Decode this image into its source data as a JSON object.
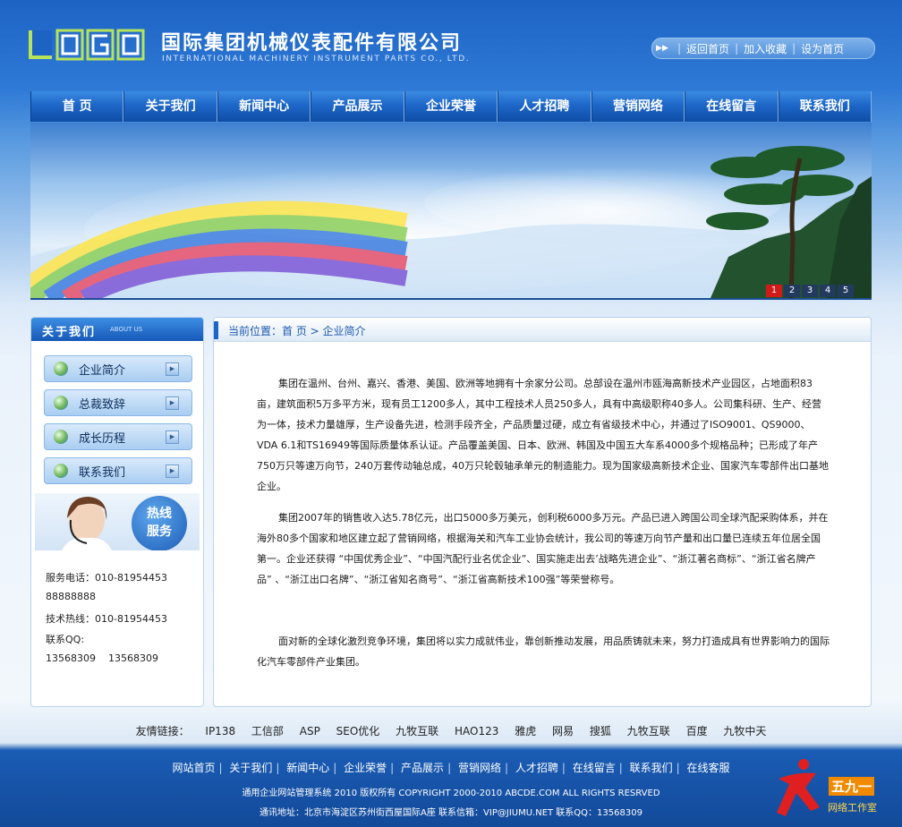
{
  "header": {
    "logo_text": "LOGO",
    "company_cn": "国际集团机械仪表配件有限公司",
    "company_en": "INTERNATIONAL MACHINERY INSTRUMENT PARTS CO., LTD.",
    "top_links": [
      "返回首页",
      "加入收藏",
      "设为首页"
    ]
  },
  "nav": [
    "首  页",
    "关于我们",
    "新闻中心",
    "产品展示",
    "企业荣誉",
    "人才招聘",
    "营销网络",
    "在线留言",
    "联系我们"
  ],
  "banner": {
    "slides": [
      "1",
      "2",
      "3",
      "4",
      "5"
    ],
    "active_slide": "1"
  },
  "sidebar": {
    "title": "关于我们",
    "subtitle": "ABOUT US",
    "items": [
      "企业简介",
      "总裁致辞",
      "成长历程",
      "联系我们"
    ],
    "hotline_badge": [
      "热线",
      "服务"
    ],
    "contact": {
      "phone_label": "服务电话：010-81954453",
      "phone_extra": "88888888",
      "tech_label": "技术热线：010-81954453",
      "qq_label": "联系QQ:",
      "qq_values": "13568309    13568309"
    }
  },
  "main": {
    "breadcrumb": "当前位置：首 页 > 企业简介",
    "paragraphs": [
      "集团在温州、台州、嘉兴、香港、美国、欧洲等地拥有十余家分公司。总部设在温州市瓯海高新技术产业园区，占地面积83亩，建筑面积5万多平方米，现有员工1200多人，其中工程技术人员250多人，具有中高级职称40多人。公司集科研、生产、经营为一体，技术力量雄厚，生产设备先进，检测手段齐全，产品质量过硬，成立有省级技术中心，并通过了ISO9001、QS9000、VDA 6.1和TS16949等国际质量体系认证。产品覆盖美国、日本、欧洲、韩国及中国五大车系4000多个规格品种；已形成了年产750万只等速万向节，240万套传动轴总成，40万只轮毂轴承单元的制造能力。现为国家级高新技术企业、国家汽车零部件出口基地企业。",
      "集团2007年的销售收入达5.78亿元，出口5000多万美元，创利税6000多万元。产品已进入跨国公司全球汽配采购体系，并在海外80多个国家和地区建立起了营销网络，根据海关和汽车工业协会统计，我公司的等速万向节产量和出口量已连续五年位居全国第一。企业还获得 “中国优秀企业”、“中国汽配行业名优企业”、国实施走出去’战略先进企业”、“浙江著名商标”、“浙江省名牌产品” 、“浙江出口名牌”、“浙江省知名商号”、“浙江省高新技术100强”等荣誉称号。",
      "面对新的全球化激烈竞争环境，集团将以实力成就伟业，靠创新推动发展，用品质铸就未来，努力打造成具有世界影响力的国际化汽车零部件产业集团。"
    ]
  },
  "friend_links": {
    "label": "友情链接：",
    "items": [
      "IP138",
      "工信部",
      "ASP",
      "SEO优化",
      "九牧互联",
      "HAO123",
      "雅虎",
      "网易",
      "搜狐",
      "九牧互联",
      "百度",
      "九牧中天"
    ]
  },
  "footer": {
    "links": [
      "网站首页",
      "关于我们",
      "新闻中心",
      "企业荣誉",
      "产品展示",
      "营销网络",
      "人才招聘",
      "在线留言",
      "联系我们",
      "在线客服"
    ],
    "copyright": "通用企业网站管理系统 2010 版权所有 COPYRIGHT 2000-2010 ABCDE.COM ALL RIGHTS RESRVED",
    "address": "通讯地址：北京市海淀区苏州街西屋国际A座 联系信箱：VIP@JIUMU.NET 联系QQ：13568309",
    "studio_num": "五九一",
    "studio_name": "网络工作室"
  },
  "colors": {
    "primary_blue": "#1659b8",
    "nav_blue": "#1e67c8",
    "active_slide_red": "#d11a1a"
  }
}
